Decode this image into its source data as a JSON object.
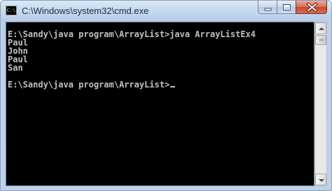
{
  "window": {
    "title": "C:\\Windows\\system32\\cmd.exe",
    "app_icon_text": "C:\\"
  },
  "console": {
    "lines": [
      "E:\\Sandy\\java program\\ArrayList>java ArrayListEx4",
      "Paul",
      "John",
      "Paul",
      "San",
      "",
      "E:\\Sandy\\java program\\ArrayList>"
    ],
    "background_color": "#000000",
    "text_color": "#c0c0c0"
  },
  "icons": {
    "minimize": "minimize-icon",
    "maximize": "maximize-icon",
    "close": "close-icon",
    "scroll_up": "chevron-up-icon",
    "scroll_down": "chevron-down-icon"
  }
}
